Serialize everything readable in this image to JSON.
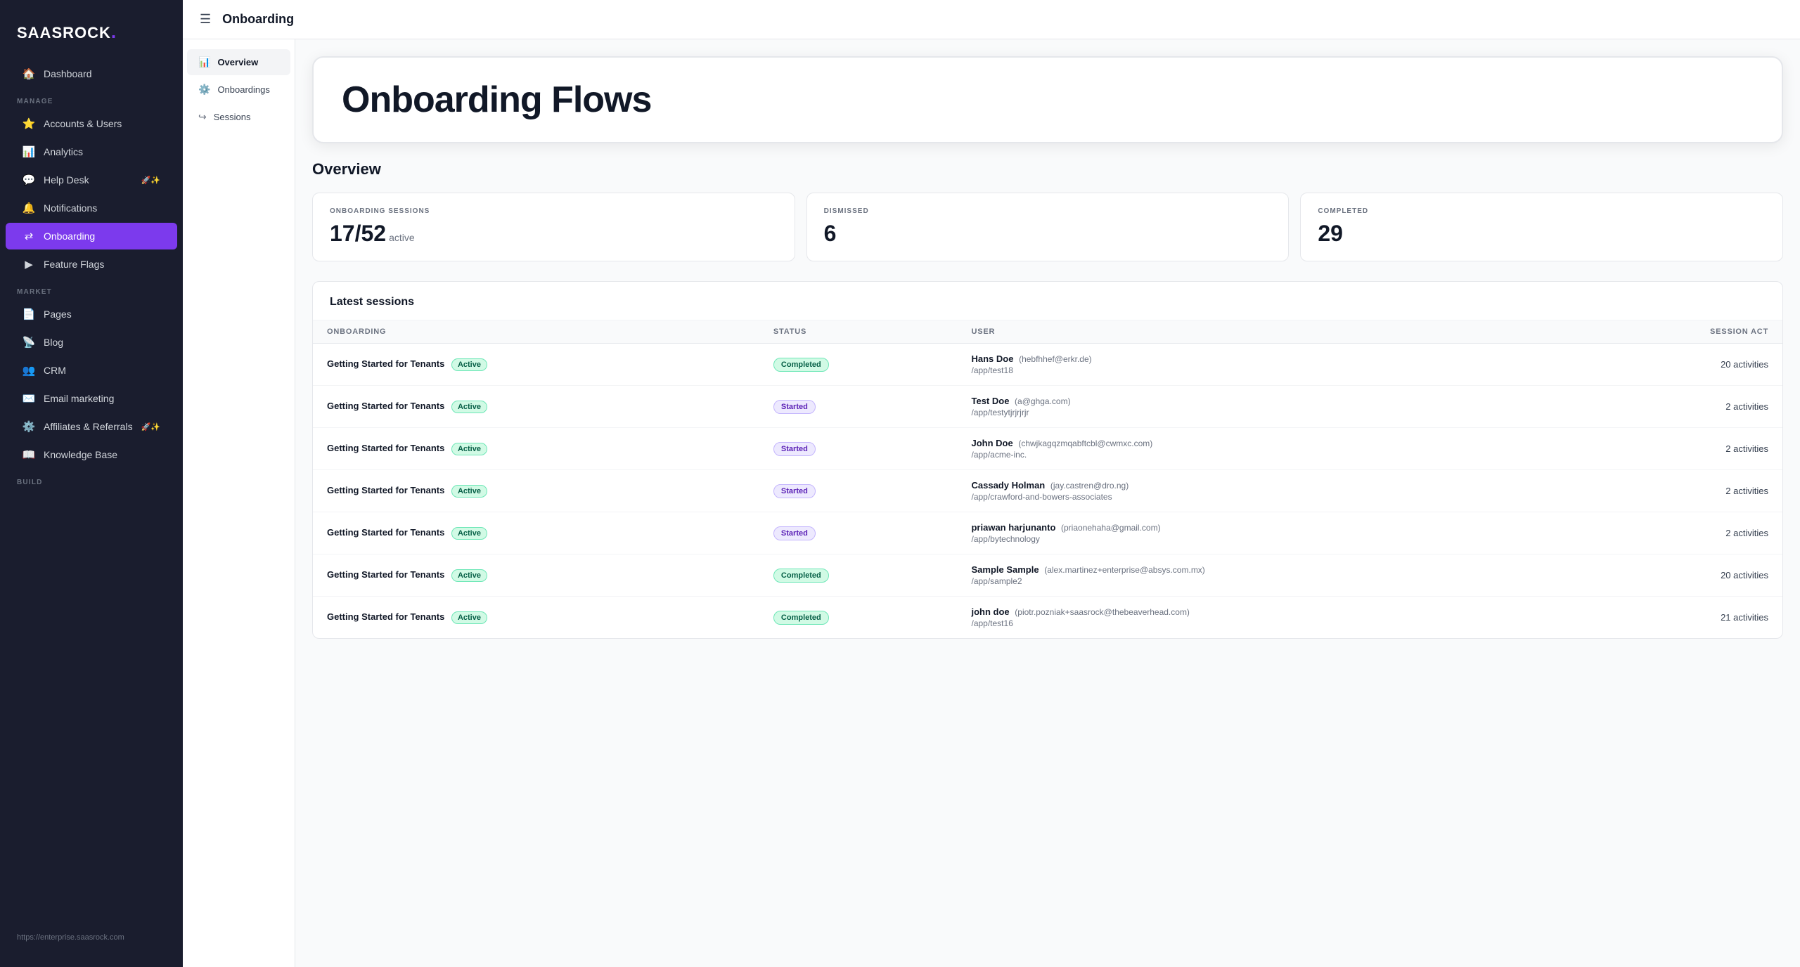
{
  "brand": {
    "name_part1": "SAAS",
    "name_part2": "ROCK",
    "dot": "."
  },
  "sidebar": {
    "manage_label": "MANAGE",
    "market_label": "MARKET",
    "build_label": "BUILD",
    "items": [
      {
        "id": "dashboard",
        "label": "Dashboard",
        "icon": "🏠"
      },
      {
        "id": "accounts-users",
        "label": "Accounts & Users",
        "icon": "⭐"
      },
      {
        "id": "analytics",
        "label": "Analytics",
        "icon": "📊"
      },
      {
        "id": "help-desk",
        "label": "Help Desk",
        "icon": "💬",
        "badge": "🚀✨"
      },
      {
        "id": "notifications",
        "label": "Notifications",
        "icon": "🔔"
      },
      {
        "id": "onboarding",
        "label": "Onboarding",
        "icon": "🔀",
        "active": true
      },
      {
        "id": "feature-flags",
        "label": "Feature Flags",
        "icon": "⚑"
      },
      {
        "id": "pages",
        "label": "Pages",
        "icon": "📄"
      },
      {
        "id": "blog",
        "label": "Blog",
        "icon": "📡"
      },
      {
        "id": "crm",
        "label": "CRM",
        "icon": "👥"
      },
      {
        "id": "email-marketing",
        "label": "Email marketing",
        "icon": "✉️"
      },
      {
        "id": "affiliates-referrals",
        "label": "Affiliates & Referrals",
        "icon": "⚙️",
        "badge": "🚀✨"
      },
      {
        "id": "knowledge-base",
        "label": "Knowledge Base",
        "icon": "📖"
      }
    ],
    "bottom_url": "https://enterprise.saasrock.com"
  },
  "header": {
    "title": "Onboarding"
  },
  "sub_nav": {
    "items": [
      {
        "id": "overview",
        "label": "Overview",
        "icon": "📊",
        "active": true
      },
      {
        "id": "onboardings",
        "label": "Onboardings",
        "icon": "⚙️"
      },
      {
        "id": "sessions",
        "label": "Sessions",
        "icon": "↪"
      }
    ]
  },
  "hero": {
    "title": "Onboarding Flows"
  },
  "page_title": "Overview",
  "stats": [
    {
      "label": "ONBOARDING SESSIONS",
      "value": "17/52",
      "suffix": "active"
    },
    {
      "label": "DISMISSED",
      "value": "6",
      "suffix": ""
    },
    {
      "label": "COMPLETED",
      "value": "29",
      "suffix": ""
    }
  ],
  "table": {
    "title": "Latest sessions",
    "columns": [
      "Onboarding",
      "Status",
      "User",
      "Session act"
    ],
    "rows": [
      {
        "onboarding": "Getting Started for Tenants",
        "onboarding_status": "Active",
        "session_status": "Completed",
        "session_status_type": "completed",
        "user_name": "Hans Doe",
        "user_email": "(hebfhhef@erkr.de)",
        "user_path": "/app/test18",
        "activities": "20 activities"
      },
      {
        "onboarding": "Getting Started for Tenants",
        "onboarding_status": "Active",
        "session_status": "Started",
        "session_status_type": "started",
        "user_name": "Test Doe",
        "user_email": "(a@ghga.com)",
        "user_path": "/app/testytjrjrjrjr",
        "activities": "2 activities"
      },
      {
        "onboarding": "Getting Started for Tenants",
        "onboarding_status": "Active",
        "session_status": "Started",
        "session_status_type": "started",
        "user_name": "John Doe",
        "user_email": "(chwjkagqzmqabftcbl@cwmxc.com)",
        "user_path": "/app/acme-inc.",
        "activities": "2 activities"
      },
      {
        "onboarding": "Getting Started for Tenants",
        "onboarding_status": "Active",
        "session_status": "Started",
        "session_status_type": "started",
        "user_name": "Cassady Holman",
        "user_email": "(jay.castren@dro.ng)",
        "user_path": "/app/crawford-and-bowers-associates",
        "activities": "2 activities"
      },
      {
        "onboarding": "Getting Started for Tenants",
        "onboarding_status": "Active",
        "session_status": "Started",
        "session_status_type": "started",
        "user_name": "priawan harjunanto",
        "user_email": "(priaonehaha@gmail.com)",
        "user_path": "/app/bytechnology",
        "activities": "2 activities"
      },
      {
        "onboarding": "Getting Started for Tenants",
        "onboarding_status": "Active",
        "session_status": "Completed",
        "session_status_type": "completed",
        "user_name": "Sample Sample",
        "user_email": "(alex.martinez+enterprise@absys.com.mx)",
        "user_path": "/app/sample2",
        "activities": "20 activities"
      },
      {
        "onboarding": "Getting Started for Tenants",
        "onboarding_status": "Active",
        "session_status": "Completed",
        "session_status_type": "completed",
        "user_name": "john doe",
        "user_email": "(piotr.pozniak+saasrock@thebeaverhead.com)",
        "user_path": "/app/test16",
        "activities": "21 activities"
      }
    ]
  }
}
